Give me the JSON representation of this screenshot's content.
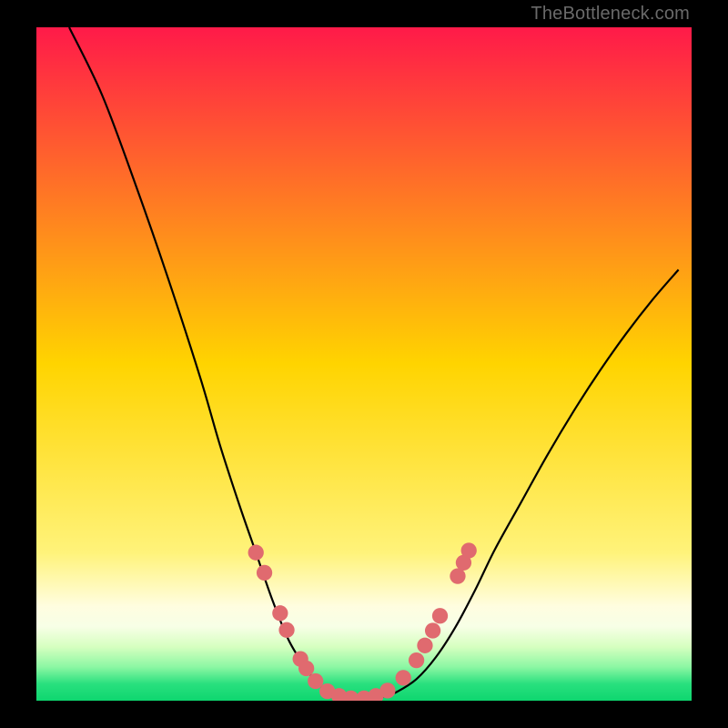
{
  "watermark": "TheBottleneck.com",
  "chart_data": {
    "type": "line",
    "title": "",
    "xlabel": "",
    "ylabel": "",
    "xlim": [
      0,
      100
    ],
    "ylim": [
      0,
      100
    ],
    "background_gradient_stops": [
      {
        "offset": 0.0,
        "color": "#ff1a49"
      },
      {
        "offset": 0.5,
        "color": "#ffd400"
      },
      {
        "offset": 0.78,
        "color": "#fff37a"
      },
      {
        "offset": 0.86,
        "color": "#fffde0"
      },
      {
        "offset": 0.89,
        "color": "#f7ffe6"
      },
      {
        "offset": 0.92,
        "color": "#d6ffc0"
      },
      {
        "offset": 0.95,
        "color": "#8cf7a3"
      },
      {
        "offset": 0.975,
        "color": "#29e07e"
      },
      {
        "offset": 1.0,
        "color": "#0ed66f"
      }
    ],
    "series": [
      {
        "name": "bottleneck-curve",
        "x": [
          5,
          10,
          15,
          20,
          25,
          28,
          31,
          33.5,
          36,
          38.5,
          41,
          43,
          45,
          47,
          49,
          51,
          53,
          55,
          58,
          61,
          64,
          67,
          70,
          74,
          78,
          82,
          86,
          90,
          94,
          98
        ],
        "y": [
          100,
          90,
          77,
          63,
          48,
          38,
          29,
          22,
          15,
          9,
          5,
          2.5,
          1.2,
          0.6,
          0.3,
          0.3,
          0.6,
          1.3,
          3.2,
          6.5,
          11,
          16.5,
          22.5,
          29.5,
          36.5,
          43,
          49,
          54.5,
          59.5,
          64
        ]
      }
    ],
    "curve_flat_bottom_pct": {
      "from_x": 44,
      "to_x": 52,
      "y": 0.3
    },
    "markers": {
      "name": "sample-points",
      "color": "#e06a6f",
      "radius_pct": 1.2,
      "points": [
        {
          "x": 33.5,
          "y": 22
        },
        {
          "x": 34.8,
          "y": 19
        },
        {
          "x": 37.2,
          "y": 13
        },
        {
          "x": 38.2,
          "y": 10.5
        },
        {
          "x": 40.3,
          "y": 6.2
        },
        {
          "x": 41.2,
          "y": 4.8
        },
        {
          "x": 42.6,
          "y": 2.9
        },
        {
          "x": 44.4,
          "y": 1.4
        },
        {
          "x": 46.2,
          "y": 0.7
        },
        {
          "x": 48.0,
          "y": 0.35
        },
        {
          "x": 50.0,
          "y": 0.35
        },
        {
          "x": 51.8,
          "y": 0.7
        },
        {
          "x": 53.6,
          "y": 1.5
        },
        {
          "x": 56.0,
          "y": 3.4
        },
        {
          "x": 58.0,
          "y": 6.0
        },
        {
          "x": 59.3,
          "y": 8.2
        },
        {
          "x": 60.5,
          "y": 10.4
        },
        {
          "x": 61.6,
          "y": 12.6
        },
        {
          "x": 64.3,
          "y": 18.5
        },
        {
          "x": 65.2,
          "y": 20.5
        },
        {
          "x": 66.0,
          "y": 22.3
        }
      ]
    }
  }
}
